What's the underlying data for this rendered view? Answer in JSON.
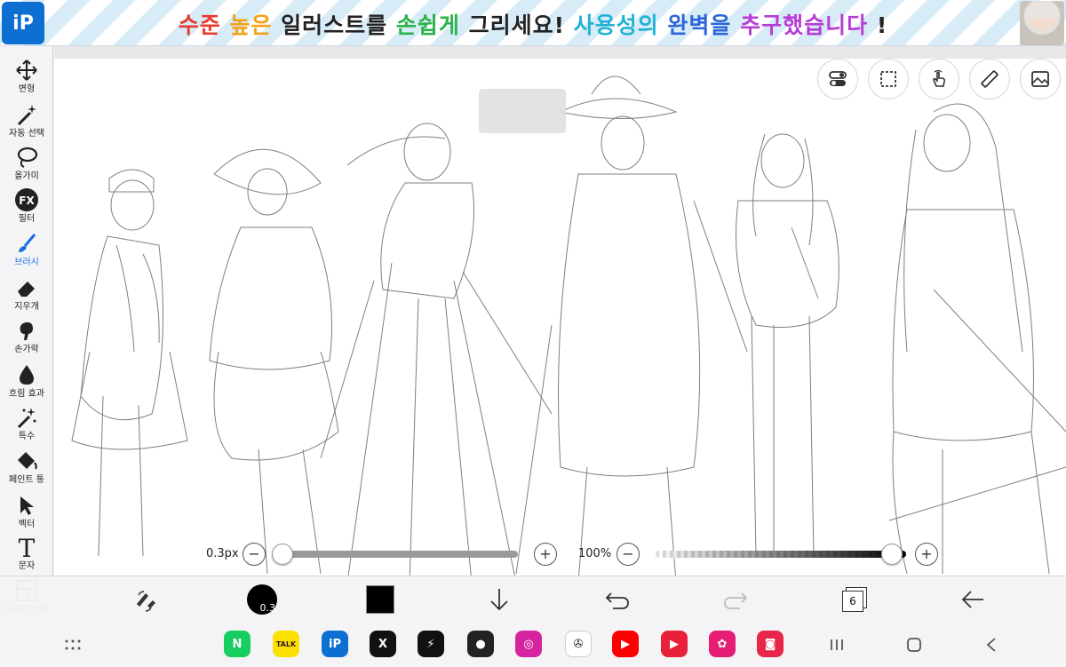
{
  "banner": {
    "logo_text": "iP",
    "segments": [
      {
        "text": "수준 ",
        "color": "#e63b2e"
      },
      {
        "text": "높은 ",
        "color": "#f2a21b"
      },
      {
        "text": "일러스트를 ",
        "color": "#222222"
      },
      {
        "text": "손쉽게 ",
        "color": "#2bb24c"
      },
      {
        "text": "그리세요! ",
        "color": "#222222"
      },
      {
        "text": "사용성의 ",
        "color": "#23b2d6"
      },
      {
        "text": "완벽을 ",
        "color": "#2b66d8"
      },
      {
        "text": "추구했습니다 ",
        "color": "#b63dd6"
      },
      {
        "text": "!",
        "color": "#222222"
      }
    ]
  },
  "tools": [
    {
      "label": "변형",
      "icon": "move-icon"
    },
    {
      "label": "자동 선택",
      "icon": "magic-wand-icon"
    },
    {
      "label": "올가미",
      "icon": "lasso-icon"
    },
    {
      "label": "필터",
      "icon": "fx-icon"
    },
    {
      "label": "브러시",
      "icon": "brush-icon",
      "active": true
    },
    {
      "label": "지우개",
      "icon": "eraser-icon"
    },
    {
      "label": "손가락",
      "icon": "smudge-icon"
    },
    {
      "label": "흐림 효과",
      "icon": "blur-drop-icon"
    },
    {
      "label": "특수",
      "icon": "special-sparkle-icon"
    },
    {
      "label": "페인트 통",
      "icon": "paint-bucket-icon"
    },
    {
      "label": "벡터",
      "icon": "vector-arrow-icon"
    },
    {
      "label": "문자",
      "icon": "text-icon"
    },
    {
      "label": "프레임 분할",
      "icon": "frame-divide-icon"
    }
  ],
  "brush_size": {
    "label": "0.3px",
    "value": 0.3,
    "minus": "−",
    "plus": "+"
  },
  "opacity": {
    "label": "100%",
    "value": 1.0,
    "minus": "−",
    "plus": "+"
  },
  "bottom": {
    "brush_preview_value": "0.3",
    "layer_count": "6",
    "primary_color": "#000000"
  },
  "dock": [
    {
      "name": "naver-app-icon",
      "label": "N",
      "bg": "#19ce60"
    },
    {
      "name": "kakaotalk-app-icon",
      "label": "TALK",
      "bg": "#fae100"
    },
    {
      "name": "ibispaint-app-icon",
      "label": "iP",
      "bg": "#0d6fd1"
    },
    {
      "name": "x-app-icon",
      "label": "X",
      "bg": "#111111"
    },
    {
      "name": "bolt-app-icon",
      "label": "⚡",
      "bg": "#111111"
    },
    {
      "name": "panda-app-icon",
      "label": "●",
      "bg": "#222222"
    },
    {
      "name": "instagram-app-icon",
      "label": "◎",
      "bg": "#d6249f"
    },
    {
      "name": "radar-app-icon",
      "label": "✇",
      "bg": "#ffffff"
    },
    {
      "name": "youtube-app-icon",
      "label": "▶",
      "bg": "#ff0000"
    },
    {
      "name": "video-player-app-icon",
      "label": "▶",
      "bg": "#e8203a"
    },
    {
      "name": "flower-app-icon",
      "label": "✿",
      "bg": "#e61e73"
    },
    {
      "name": "camera-app-icon",
      "label": "◙",
      "bg": "#e8264a"
    }
  ]
}
